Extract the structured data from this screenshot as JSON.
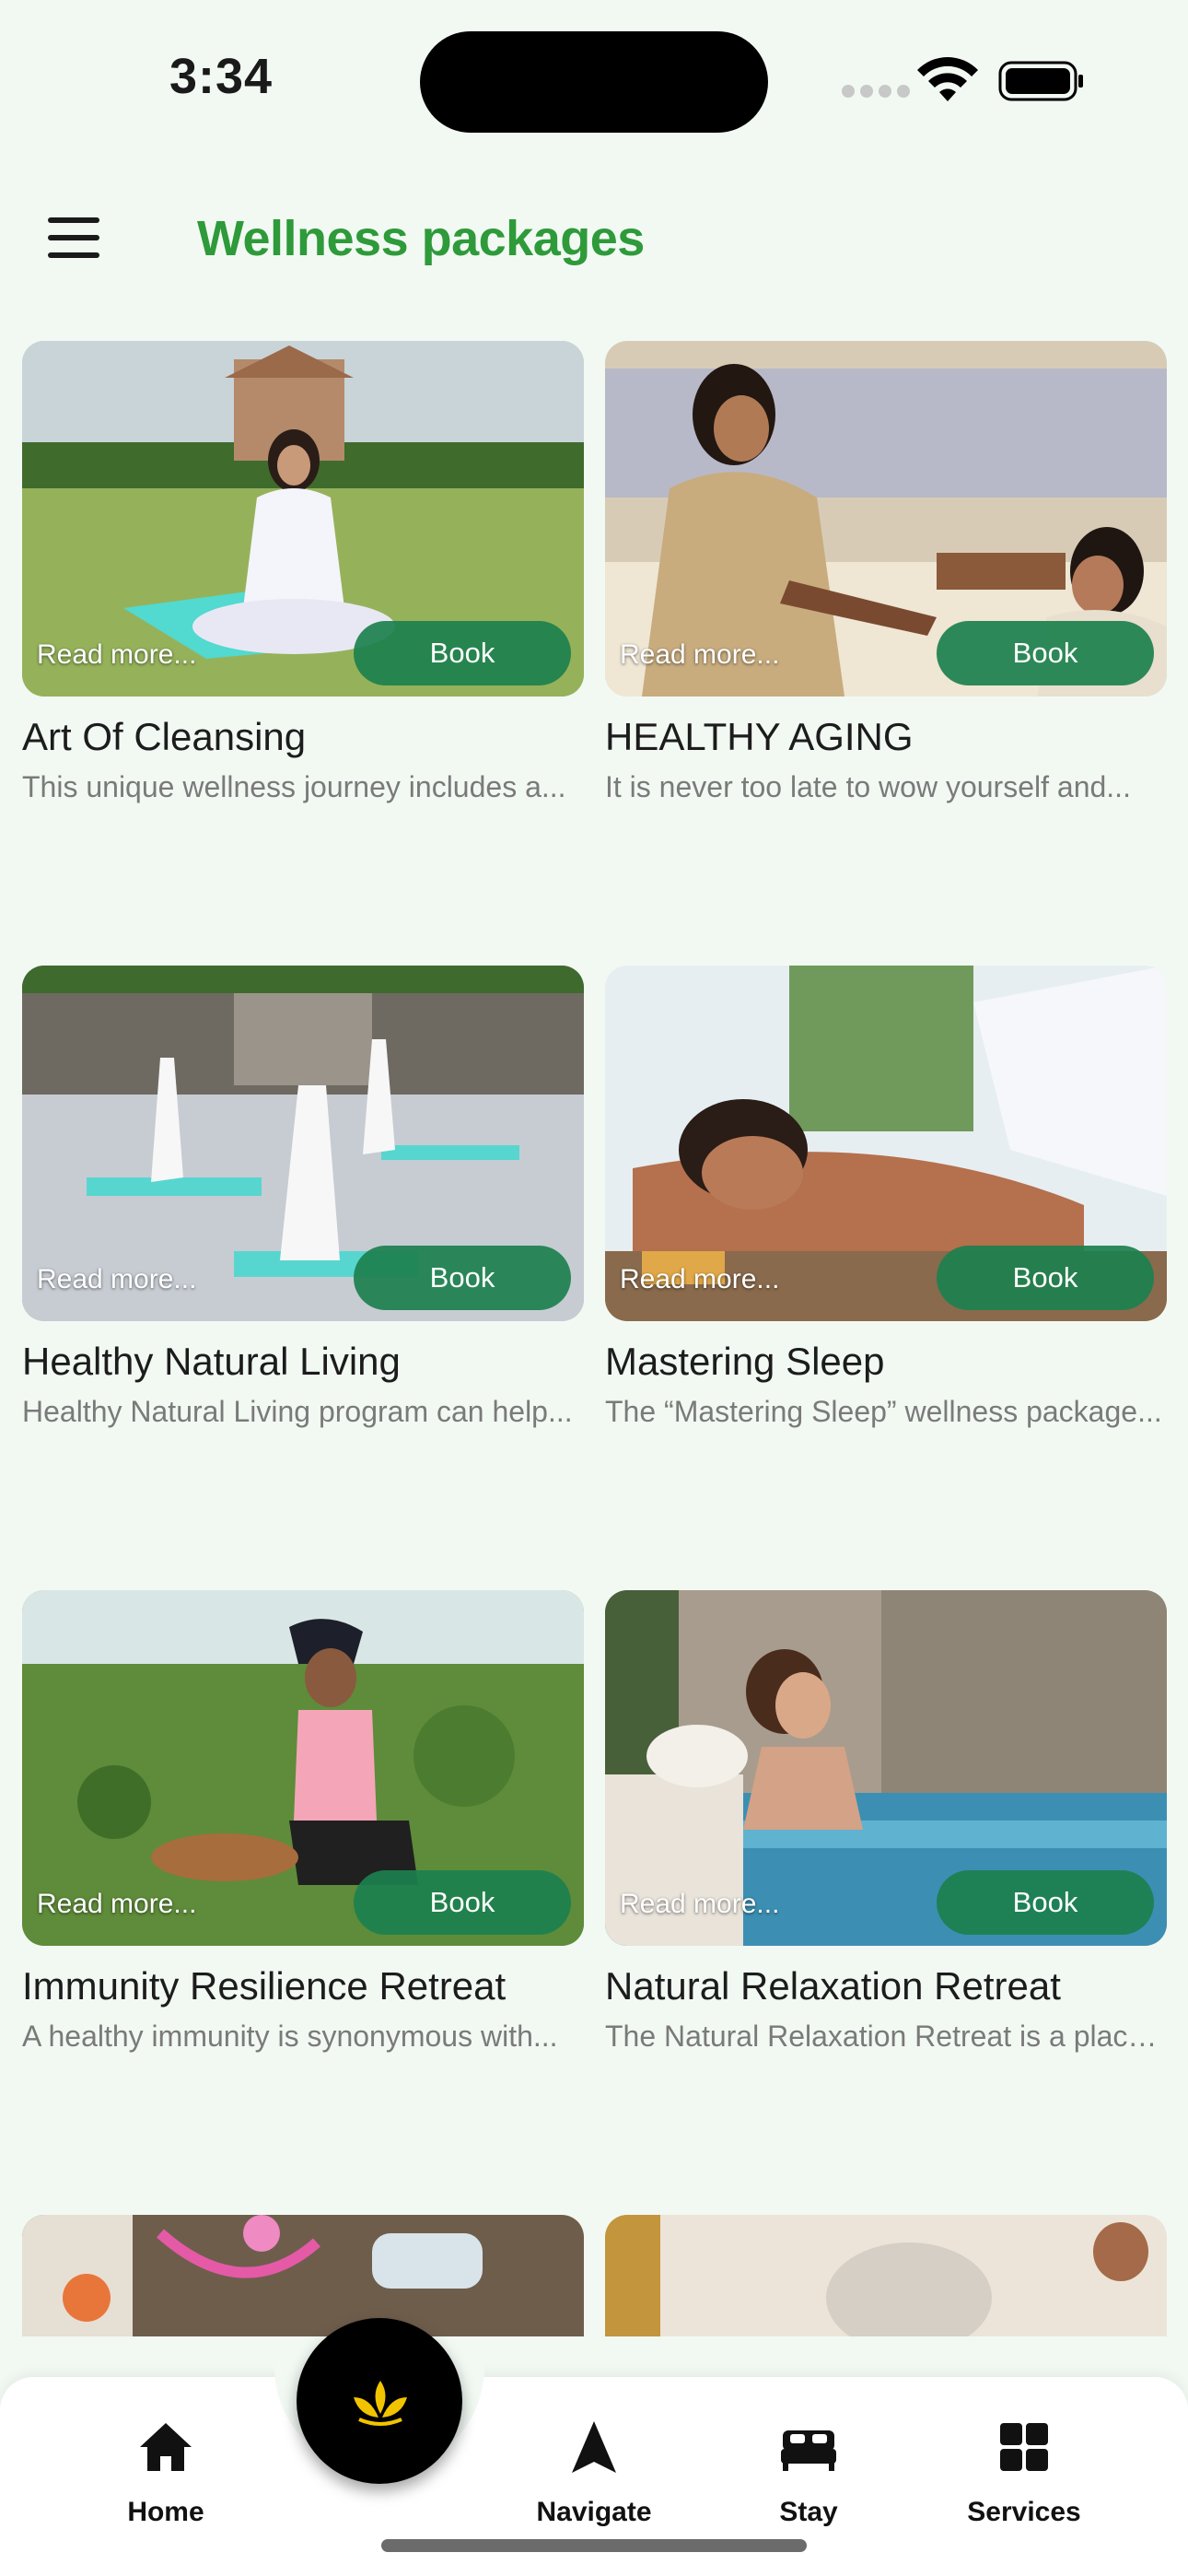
{
  "status_bar": {
    "time": "3:34"
  },
  "header": {
    "title": "Wellness packages",
    "menu_icon": "hamburger-menu-icon"
  },
  "card_actions": {
    "read_more": "Read more...",
    "book": "Book"
  },
  "packages": [
    {
      "title": "Art Of Cleansing",
      "description": "This unique wellness journey includes a..."
    },
    {
      "title": "HEALTHY AGING",
      "description": "It is never too late to wow yourself and..."
    },
    {
      "title": "Healthy Natural Living",
      "description": "Healthy Natural Living program can help..."
    },
    {
      "title": "Mastering Sleep",
      "description": "The “Mastering Sleep” wellness package..."
    },
    {
      "title": "Immunity Resilience Retreat",
      "description": "A healthy immunity is synonymous with..."
    },
    {
      "title": "Natural Relaxation Retreat",
      "description": "The Natural Relaxation Retreat is a place..."
    }
  ],
  "bottom_nav": {
    "center_icon": "lotus-icon",
    "items": [
      {
        "label": "Home",
        "icon": "home-icon"
      },
      {
        "label": "Navigate",
        "icon": "navigate-arrow-icon"
      },
      {
        "label": "Stay",
        "icon": "bed-icon"
      },
      {
        "label": "Services",
        "icon": "grid-icon"
      }
    ]
  },
  "colors": {
    "background": "#f2f9f3",
    "title_green": "#2e9a3a",
    "book_button": "#1c804e",
    "fab": "#000000",
    "lotus": "#f2c400"
  }
}
